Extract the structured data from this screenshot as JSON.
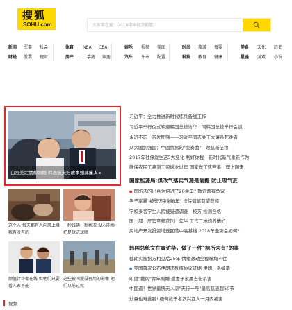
{
  "header": {
    "logo_cn": "搜狐",
    "logo_en": "SOHU.com",
    "search_placeholder": "大家都在搜：2018中国经济前瞻",
    "brand_color": "#ffd800",
    "search_icon": "search-icon"
  },
  "nav": {
    "row1": [
      "新闻",
      "军事",
      "社会",
      "体育",
      "NBA",
      "CBA",
      "娱乐",
      "视频",
      "美图",
      "时尚",
      "旅游",
      "母婴",
      "美食",
      "文化",
      "历史"
    ],
    "row2": [
      "财经",
      "股票",
      "理财",
      "房产",
      "二手房",
      "家居",
      "汽车",
      "车市",
      "配置",
      "科技",
      "教育",
      "健康",
      "星座",
      "游戏",
      "小说"
    ]
  },
  "featured": {
    "caption": "白宫美定情却眼眶 韩总统夫妇故事如此感人",
    "active_slide": 1,
    "slides": 4
  },
  "thumbs": [
    {
      "caption": "这个人 每天都有人向风上接我有没有的"
    },
    {
      "caption": "一秒钱辆一秒状况 没人能挽把足球进球顺"
    },
    {
      "caption": "颜值计华都在线 但他们只要看人家不能"
    },
    {
      "caption": "这些被叫漫没有用的影像 他们以前过就"
    }
  ],
  "headlines": [
    {
      "text": "习近平：全力推进新时代练兵备战工作",
      "type": "normal"
    },
    {
      "text": "习近平举行仪式欢迎韩国总统访华　同韩国总统举行会谈",
      "type": "normal"
    },
    {
      "text": "永远不忘　奋发图强——习近平同志关于大屠杀死难者",
      "type": "normal"
    },
    {
      "text": "从大国到强国：中国贸易的\"变奏曲\"　领航新征程",
      "type": "normal"
    },
    {
      "text": "2017年社保发生这5大变化 利好你我　新时代新气象新作为",
      "type": "normal"
    },
    {
      "text": "确保农民工拿到工资返乡过年 国家做了这些事　理上网来",
      "type": "normal"
    },
    {
      "text": "国家能源局:煤改气落实气源是前提 防止现气荒",
      "type": "big"
    },
    {
      "text": "国防法的出台为何迟了20余年? 歌词背有争议",
      "type": "red"
    },
    {
      "text": "男子家暴\"被警方判拘8年\" 法院调解有望获释",
      "type": "normal"
    },
    {
      "text": "学校多名学生入院被疑遭调查　校方 检测合格",
      "type": "normal"
    },
    {
      "text": "国土部一厅官至频获刑十年半 工作三地均养情妇",
      "type": "normal"
    },
    {
      "text": "房地产开发投资增速回落中高基线 2018年走势会如何?",
      "type": "normal"
    },
    {
      "text": "韩国总统文在寅访华，做了一件\"前所未有\"的事",
      "type": "big"
    },
    {
      "text": "截期实被拐方相见后25年 情绪激动全程嘴角不住",
      "type": "normal"
    },
    {
      "text": "美国首次公布伊朗违反核协议证据 伊朗：系编造",
      "type": "blue"
    },
    {
      "text": "印度\"戴冈\"青年离婚 遭妻子家属当街杀害",
      "type": "normal"
    },
    {
      "text": "中国道！世界最快无人驱\"天行一号\"最高航速超50节",
      "type": "normal"
    },
    {
      "text": "幼童也难逃脱! 缅甸数千名罗兴亚人一月内被害",
      "type": "normal"
    }
  ],
  "bottom": {
    "label": "视频"
  }
}
